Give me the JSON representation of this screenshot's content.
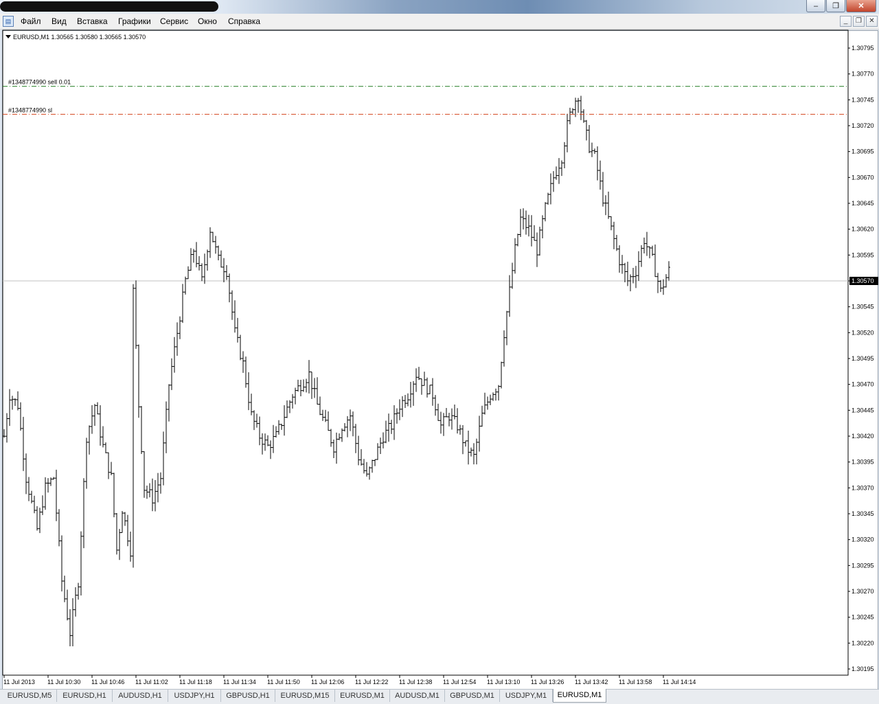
{
  "window": {
    "controls": [
      "–",
      "❐",
      "✕"
    ]
  },
  "menu": {
    "items": [
      "Файл",
      "Вид",
      "Вставка",
      "Графики",
      "Сервис",
      "Окно",
      "Справка"
    ],
    "mdi_controls": [
      "_",
      "❐",
      "✕"
    ]
  },
  "chart": {
    "header": "EURUSD,M1  1.30565 1.30580 1.30565 1.30570",
    "current_price": "1.30570",
    "orders": [
      {
        "label": "#1348774990 sell 0.01",
        "price": 1.30758,
        "color": "#1f7a1f"
      },
      {
        "label": "#1348774990 sl",
        "price": 1.30731,
        "color": "#d4441c"
      }
    ]
  },
  "chart_data": {
    "type": "ohlc",
    "symbol": "EURUSD",
    "timeframe": "M1",
    "price_labels": [
      "1.30795",
      "1.30770",
      "1.30745",
      "1.30720",
      "1.30695",
      "1.30670",
      "1.30645",
      "1.30620",
      "1.30595",
      "1.30570",
      "1.30545",
      "1.30520",
      "1.30495",
      "1.30470",
      "1.30445",
      "1.30420",
      "1.30395",
      "1.30370",
      "1.30345",
      "1.30320",
      "1.30295",
      "1.30270",
      "1.30245",
      "1.30220",
      "1.30195"
    ],
    "ylim": [
      1.30195,
      1.30795
    ],
    "time_labels": [
      "11 Jul 2013",
      "11 Jul 10:30",
      "11 Jul 10:46",
      "11 Jul 11:02",
      "11 Jul 11:18",
      "11 Jul 11:34",
      "11 Jul 11:50",
      "11 Jul 12:06",
      "11 Jul 12:22",
      "11 Jul 12:38",
      "11 Jul 12:54",
      "11 Jul 13:10",
      "11 Jul 13:26",
      "11 Jul 13:42",
      "11 Jul 13:58",
      "11 Jul 14:14"
    ],
    "current_price": 1.3057,
    "anchors": [
      [
        0,
        1.3042
      ],
      [
        2,
        1.3046
      ],
      [
        5,
        1.3045
      ],
      [
        8,
        1.3038
      ],
      [
        12,
        1.3033
      ],
      [
        15,
        1.3037
      ],
      [
        18,
        1.3038
      ],
      [
        21,
        1.3028
      ],
      [
        24,
        1.3023
      ],
      [
        27,
        1.3028
      ],
      [
        30,
        1.3042
      ],
      [
        33,
        1.3045
      ],
      [
        36,
        1.3041
      ],
      [
        39,
        1.3038
      ],
      [
        41,
        1.3031
      ],
      [
        43,
        1.3035
      ],
      [
        46,
        1.3031
      ],
      [
        47,
        1.3056
      ],
      [
        49,
        1.3045
      ],
      [
        51,
        1.3037
      ],
      [
        54,
        1.3036
      ],
      [
        57,
        1.3038
      ],
      [
        60,
        1.3047
      ],
      [
        63,
        1.3052
      ],
      [
        66,
        1.3057
      ],
      [
        69,
        1.306
      ],
      [
        72,
        1.3057
      ],
      [
        75,
        1.3062
      ],
      [
        78,
        1.3059
      ],
      [
        81,
        1.3058
      ],
      [
        84,
        1.3052
      ],
      [
        87,
        1.3049
      ],
      [
        90,
        1.3044
      ],
      [
        93,
        1.3042
      ],
      [
        96,
        1.3041
      ],
      [
        99,
        1.3042
      ],
      [
        102,
        1.3044
      ],
      [
        105,
        1.3046
      ],
      [
        108,
        1.3047
      ],
      [
        111,
        1.3048
      ],
      [
        114,
        1.3045
      ],
      [
        117,
        1.3043
      ],
      [
        120,
        1.3041
      ],
      [
        123,
        1.3043
      ],
      [
        126,
        1.3044
      ],
      [
        129,
        1.304
      ],
      [
        132,
        1.3038
      ],
      [
        135,
        1.304
      ],
      [
        138,
        1.3042
      ],
      [
        141,
        1.3043
      ],
      [
        144,
        1.3045
      ],
      [
        147,
        1.3046
      ],
      [
        150,
        1.3048
      ],
      [
        153,
        1.3047
      ],
      [
        156,
        1.3046
      ],
      [
        159,
        1.3043
      ],
      [
        162,
        1.3044
      ],
      [
        165,
        1.3043
      ],
      [
        168,
        1.3041
      ],
      [
        171,
        1.304
      ],
      [
        174,
        1.3044
      ],
      [
        177,
        1.3046
      ],
      [
        180,
        1.3047
      ],
      [
        182,
        1.3052
      ],
      [
        184,
        1.3056
      ],
      [
        186,
        1.306
      ],
      [
        188,
        1.3063
      ],
      [
        191,
        1.3062
      ],
      [
        194,
        1.306
      ],
      [
        197,
        1.3064
      ],
      [
        200,
        1.3067
      ],
      [
        203,
        1.3069
      ],
      [
        205,
        1.3072
      ],
      [
        207,
        1.3074
      ],
      [
        209,
        1.3075
      ],
      [
        211,
        1.3072
      ],
      [
        213,
        1.307
      ],
      [
        215,
        1.3069
      ],
      [
        218,
        1.3065
      ],
      [
        221,
        1.3062
      ],
      [
        224,
        1.3059
      ],
      [
        227,
        1.3057
      ],
      [
        230,
        1.3058
      ],
      [
        233,
        1.3061
      ],
      [
        236,
        1.3059
      ],
      [
        239,
        1.3056
      ],
      [
        242,
        1.3058
      ]
    ]
  },
  "tabs": [
    "EURUSD,M5",
    "EURUSD,H1",
    "AUDUSD,H1",
    "USDJPY,H1",
    "GBPUSD,H1",
    "EURUSD,M15",
    "EURUSD,M1",
    "AUDUSD,M1",
    "GBPUSD,M1",
    "USDJPY,M1",
    "EURUSD,M1"
  ],
  "active_tab": 10
}
